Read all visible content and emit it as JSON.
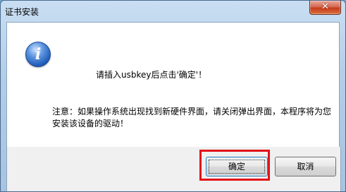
{
  "window": {
    "title": "证书安装",
    "close_label": "✕"
  },
  "dialog": {
    "icon": "info-icon",
    "message_main": "请插入usbkey后点击'确定'！",
    "message_note": "注意：如果操作系统出现找到新硬件界面，请关闭弹出界面，本程序将为您安装该设备的驱动！"
  },
  "buttons": {
    "ok_label": "确定",
    "cancel_label": "取消"
  },
  "colors": {
    "highlight": "#e3121a",
    "close_button": "#c53b1d"
  }
}
